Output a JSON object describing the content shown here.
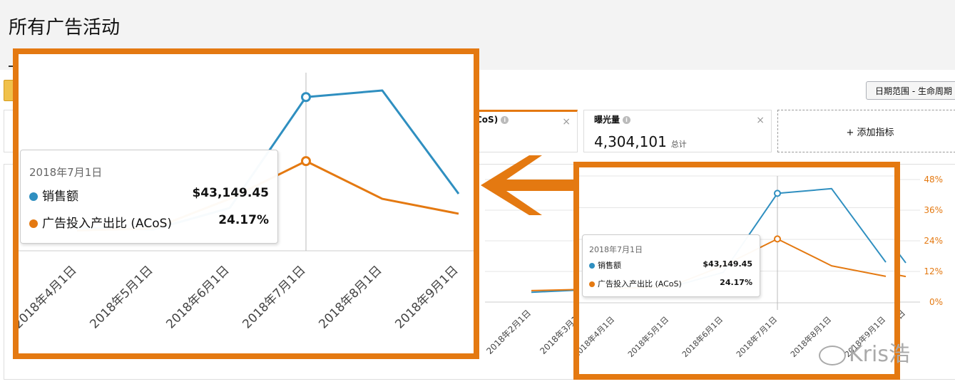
{
  "page": {
    "title": "所有广告活动"
  },
  "toolbar": {
    "date_range_label": "日期范围 - 生命周期"
  },
  "metrics": {
    "acos_card": {
      "label_fragment": "CoS)",
      "close": "×"
    },
    "impressions_card": {
      "label": "曝光量",
      "value": "4,304,101",
      "sub": "总计",
      "close": "×"
    },
    "add_metric": {
      "label": "+ 添加指标"
    }
  },
  "colors": {
    "sales": "#2f8fc0",
    "acos": "#e47911",
    "highlight_frame": "#e47911"
  },
  "icons": {
    "info": "info-icon",
    "close": "close-icon",
    "arrow": "left-arrow-icon"
  },
  "tooltip": {
    "date": "2018年7月1日",
    "rows": [
      {
        "label": "销售额",
        "value": "$43,149.45"
      },
      {
        "label": "广告投入产出比 (ACoS)",
        "value": "24.17%"
      }
    ]
  },
  "chart_data": {
    "type": "line",
    "x": [
      "2018年2月1日",
      "2018年3月1日",
      "2018年4月1日",
      "2018年5月1日",
      "2018年6月1日",
      "2018年7月1日",
      "2018年8月1日",
      "2018年9月1日"
    ],
    "series": [
      {
        "name": "销售额",
        "values": [
          4000,
          5000,
          6500,
          6000,
          12000,
          43149.45,
          45000,
          16000
        ]
      },
      {
        "name": "广告投入产出比 (ACoS)",
        "values": [
          4.5,
          5.0,
          5.5,
          6.0,
          14.0,
          24.17,
          14.0,
          10.0
        ]
      }
    ],
    "y_right_ticks": [
      "48%",
      "36%",
      "24%",
      "12%",
      "0%"
    ],
    "y_right_range": [
      0,
      48
    ],
    "highlight_x": "2018年7月1日"
  },
  "watermark": {
    "text": "Kris浩"
  }
}
